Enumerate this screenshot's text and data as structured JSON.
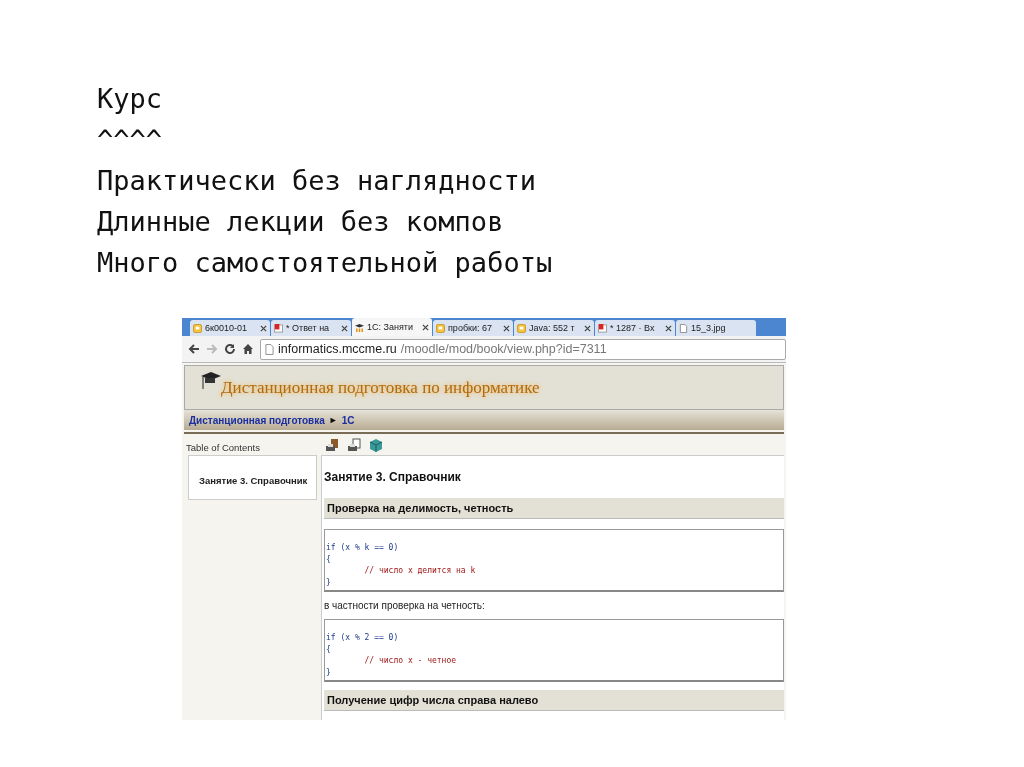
{
  "slide": {
    "lines": [
      "Курс",
      "^^^^",
      "Практически без наглядности",
      "Длинные лекции без компов",
      "Много самостоятельной работы"
    ]
  },
  "browser": {
    "tabs": [
      {
        "label": "6к0010-01",
        "kind": "note",
        "selected": false
      },
      {
        "label": "* Ответ на",
        "kind": "mail",
        "selected": false
      },
      {
        "label": "1С: Заняти",
        "kind": "moodle",
        "selected": true
      },
      {
        "label": "пробки: 67",
        "kind": "note",
        "selected": false
      },
      {
        "label": "Java: 552 т",
        "kind": "note",
        "selected": false
      },
      {
        "label": "* 1287 · Вх",
        "kind": "mail",
        "selected": false
      },
      {
        "label": "15_3.jpg",
        "kind": "file",
        "selected": false
      }
    ],
    "address": {
      "host": "informatics.mccme.ru",
      "path": "/moodle/mod/book/view.php?id=7311"
    }
  },
  "site": {
    "title": "Дистанционная подготовка по информатике",
    "breadcrumb": [
      {
        "label": "Дистанционная подготовка",
        "kind": "link"
      },
      {
        "label": "►",
        "kind": "separator"
      },
      {
        "label": "1С",
        "kind": "link"
      }
    ],
    "toc": {
      "heading": "Table of Contents",
      "items": [
        "Занятие 3. Справочник"
      ]
    },
    "page_title": "Занятие 3. Справочник",
    "blocks": [
      {
        "kind": "section",
        "text": "Проверка на делимость, четность"
      },
      {
        "kind": "code",
        "lines": [
          {
            "kind": "code",
            "text": "if (x % k == 0)"
          },
          {
            "kind": "code",
            "text": "{"
          },
          {
            "kind": "comment",
            "text": "        // число x делится на k"
          },
          {
            "kind": "code",
            "text": "}"
          }
        ]
      },
      {
        "kind": "text",
        "text": "в частности проверка на четность:"
      },
      {
        "kind": "code",
        "lines": [
          {
            "kind": "code",
            "text": "if (x % 2 == 0)"
          },
          {
            "kind": "code",
            "text": "{"
          },
          {
            "kind": "comment",
            "text": "        // число x - четное"
          },
          {
            "kind": "code",
            "text": "}"
          }
        ]
      },
      {
        "kind": "section",
        "text": "Получение цифр числа справа налево"
      }
    ]
  }
}
